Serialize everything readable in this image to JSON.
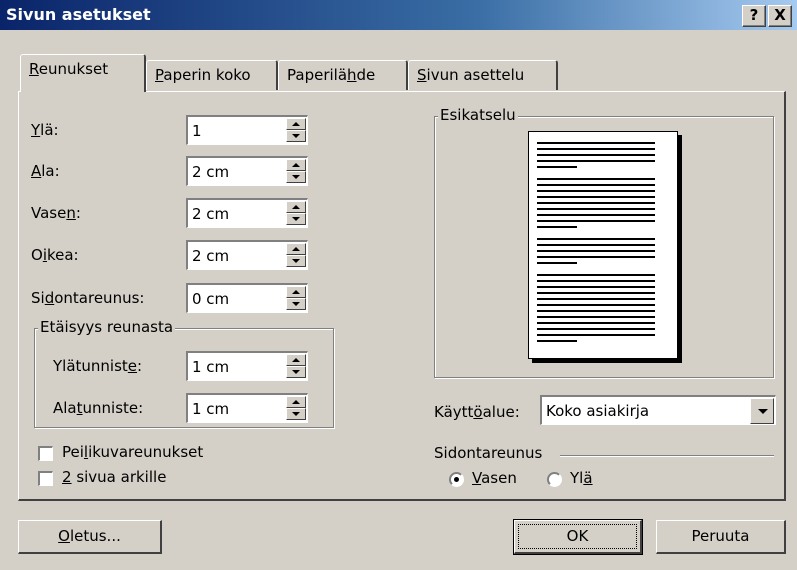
{
  "window": {
    "title": "Sivun asetukset",
    "help_label": "?",
    "close_label": "X"
  },
  "tabs": [
    {
      "label_pre": "",
      "label_key": "R",
      "label_post": "eunukset"
    },
    {
      "label_pre": "",
      "label_key": "P",
      "label_post": "aperin koko"
    },
    {
      "label_pre": "Paperilä",
      "label_key": "h",
      "label_post": "de"
    },
    {
      "label_pre": "",
      "label_key": "S",
      "label_post": "ivun asettelu"
    }
  ],
  "margins": {
    "top": {
      "pre": "",
      "key": "Y",
      "post": "lä:",
      "value": "1"
    },
    "bottom": {
      "pre": "",
      "key": "A",
      "post": "la:",
      "value": "2 cm"
    },
    "left": {
      "pre": "Vase",
      "key": "n",
      "post": ":",
      "value": "2 cm"
    },
    "right": {
      "pre": "O",
      "key": "i",
      "post": "kea:",
      "value": "2 cm"
    },
    "gutter": {
      "pre": "Si",
      "key": "d",
      "post": "ontareunus:",
      "value": "0 cm"
    }
  },
  "edge_distance": {
    "legend": "Etäisyys reunasta",
    "header": {
      "pre": "Ylätunnist",
      "key": "e",
      "post": ":",
      "value": "1 cm"
    },
    "footer": {
      "pre": "Ala",
      "key": "t",
      "post": "unniste:",
      "value": "1 cm"
    }
  },
  "options": {
    "mirror": {
      "pre": "Pei",
      "key": "l",
      "post": "ikuvareunukset",
      "checked": false
    },
    "two_pages": {
      "pre": "",
      "key": "2",
      "post": " sivua arkille",
      "checked": false
    }
  },
  "preview": {
    "legend": "Esikatselu"
  },
  "apply_to": {
    "pre": "Käytt",
    "key": "ö",
    "post": "alue:",
    "value": "Koko asiakirja"
  },
  "gutter_position": {
    "legend": "Sidontareunus",
    "left": {
      "key": "V",
      "post": "asen",
      "selected": true
    },
    "top": {
      "pre": "Yl",
      "key": "ä",
      "selected": false
    }
  },
  "buttons": {
    "default": {
      "key": "O",
      "post": "letus..."
    },
    "ok": "OK",
    "cancel": "Peruuta"
  },
  "colors": {
    "face": "#d4d0c8",
    "title_start": "#0a246a",
    "title_end": "#a6caf0"
  }
}
